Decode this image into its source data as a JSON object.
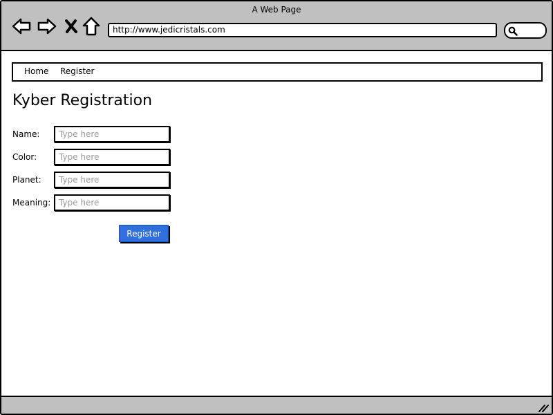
{
  "browser": {
    "title": "A Web Page",
    "url": "http://www.jedicristals.com",
    "buttons": [
      {
        "name": "back-icon"
      },
      {
        "name": "forward-icon"
      },
      {
        "name": "close-icon"
      },
      {
        "name": "home-icon"
      }
    ],
    "search_icon": "search-icon"
  },
  "menu": {
    "items": [
      {
        "label": "Home"
      },
      {
        "label": "Register"
      }
    ]
  },
  "page": {
    "heading": "Kyber Registration"
  },
  "form": {
    "fields": [
      {
        "label": "Name:",
        "placeholder": "Type here"
      },
      {
        "label": "Color:",
        "placeholder": "Type here"
      },
      {
        "label": "Planet:",
        "placeholder": "Type here"
      },
      {
        "label": "Meaning:",
        "placeholder": "Type here"
      }
    ],
    "submit_label": "Register"
  },
  "colors": {
    "chrome": "#c0c0c0",
    "button": "#2f6fde",
    "placeholder": "#9a9a9a"
  }
}
